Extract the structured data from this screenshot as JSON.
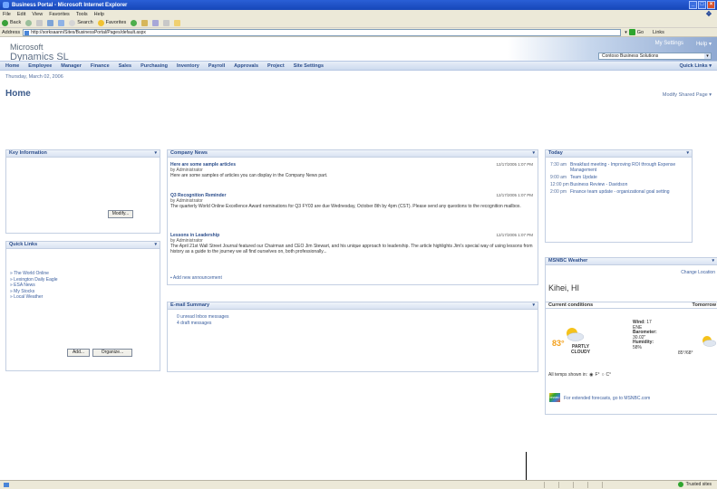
{
  "window": {
    "title": "Business Portal - Microsoft Internet Explorer"
  },
  "menu": [
    "File",
    "Edit",
    "View",
    "Favorites",
    "Tools",
    "Help"
  ],
  "toolbar": {
    "back": "Back",
    "search": "Search",
    "favorites": "Favorites"
  },
  "address": {
    "label": "Address",
    "url": "http://sorksaann/Sites/BusinessPortal/Pages/default.aspx",
    "go": "Go",
    "links": "Links"
  },
  "app": {
    "brand_top": "Microsoft",
    "brand_bottom": "Dynamics SL",
    "my_settings": "My Settings",
    "help": "Help",
    "company": "Contoso Business Solutions"
  },
  "nav": {
    "items": [
      "Home",
      "Employee",
      "Manager",
      "Finance",
      "Sales",
      "Purchasing",
      "Inventory",
      "Payroll",
      "Approvals",
      "Project",
      "Site Settings"
    ],
    "quick_links": "Quick Links"
  },
  "date": "Thursday, March 02, 2006",
  "page_title": "Home",
  "modify_shared": "Modify Shared Page",
  "key_info": {
    "title": "Key Information",
    "modify_btn": "Modify..."
  },
  "quick_links": {
    "title": "Quick Links",
    "items": [
      "The World Online",
      "Lexington Daily Eagle",
      "ESA News",
      "My Stocks",
      "Local Weather"
    ],
    "add_btn": "Add...",
    "organize_btn": "Organize..."
  },
  "company_news": {
    "title": "Company News",
    "articles": [
      {
        "title": "Here are some sample articles",
        "by": "by Administrator",
        "date": "12/17/2005 1:07 PM",
        "body": "Here are some samples of articles you can display in the Company News part."
      },
      {
        "title": "Q3 Recognition Reminder",
        "by": "by Administrator",
        "date": "12/17/2005 1:07 PM",
        "body": "The quarterly World Online Excellence Award nominations for Q3 FY03 are due Wednesday, October 8th by 4pm (CST). Please send any questions to the recognition mailbox."
      },
      {
        "title": "Lessons in Leadership",
        "by": "by Administrator",
        "date": "12/17/2005 1:07 PM",
        "body": "The April 21st Wall Street Journal featured our Chairman and CEO Jim Stewart, and his unique approach to leadership. The article highlights Jim's special way of using lessons from history as a guide to the journey we all find ourselves on, both professionally..."
      }
    ],
    "add_new": "Add new announcement"
  },
  "email": {
    "title": "E-mail Summary",
    "unread": "0 unread Inbox messages",
    "draft": "4 draft messages"
  },
  "today": {
    "title": "Today",
    "events": [
      {
        "time": "7:30 am",
        "text": "Breakfast meeting - Improving ROI through Expense Management"
      },
      {
        "time": "9:00 am",
        "text": "Team Update"
      },
      {
        "time": "12:00 pm",
        "text": "Business Review - Davidson"
      },
      {
        "time": "2:00 pm",
        "text": "Finance team update - organizational goal setting"
      }
    ]
  },
  "weather": {
    "title": "MSNBC Weather",
    "change_location": "Change Location",
    "city": "Kihei, HI",
    "current_label": "Current conditions",
    "tomorrow_label": "Tomorrow",
    "temp": "83°",
    "condition_line1": "PARTLY",
    "condition_line2": "CLOUDY",
    "wind_label": "Wind:",
    "wind_value": "17",
    "wind_dir": "ENE",
    "barometer_label": "Barometer:",
    "barometer_value": "30.02\"",
    "humidity_label": "Humidity:",
    "humidity_value": "58%",
    "tomorrow_temp": "85°/68°",
    "units_label": "All temps shown in:",
    "unit_f": "F°",
    "unit_c": "C°",
    "msnbc_footer": "For extended forecasts, go to MSNBC.com",
    "msnbc_logo": "MSNBC"
  },
  "status": {
    "zone": "Trusted sites"
  },
  "colors": {
    "nav_text": "#2b4d8b",
    "title_blue": "#1646b8",
    "link": "#3b5f9f"
  }
}
